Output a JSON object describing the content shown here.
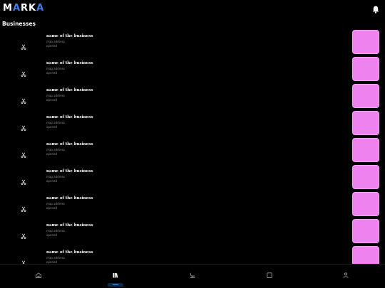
{
  "header": {
    "logo_text": "MARKA",
    "logo_accent_color": "#3f7fe6",
    "notification_icon": "bell-icon"
  },
  "section": {
    "title": "Businesses"
  },
  "businesses": [
    {
      "name": "name of the business",
      "address": "map address",
      "status": "opened",
      "category_icon": "scissors-icon",
      "thumb_color": "#ee82ee"
    },
    {
      "name": "name of the business",
      "address": "map address",
      "status": "opened",
      "category_icon": "scissors-icon",
      "thumb_color": "#ee82ee"
    },
    {
      "name": "name of the business",
      "address": "map address",
      "status": "opened",
      "category_icon": "scissors-icon",
      "thumb_color": "#ee82ee"
    },
    {
      "name": "name of the business",
      "address": "map address",
      "status": "opened",
      "category_icon": "scissors-icon",
      "thumb_color": "#ee82ee"
    },
    {
      "name": "name of the business",
      "address": "map address",
      "status": "opened",
      "category_icon": "scissors-icon",
      "thumb_color": "#ee82ee"
    },
    {
      "name": "name of the business",
      "address": "map address",
      "status": "opened",
      "category_icon": "scissors-icon",
      "thumb_color": "#ee82ee"
    },
    {
      "name": "name of the business",
      "address": "map address",
      "status": "opened",
      "category_icon": "scissors-icon",
      "thumb_color": "#ee82ee"
    },
    {
      "name": "name of the business",
      "address": "map address",
      "status": "opened",
      "category_icon": "scissors-icon",
      "thumb_color": "#ee82ee"
    },
    {
      "name": "name of the business",
      "address": "map address",
      "status": "opened",
      "category_icon": "scissors-icon",
      "thumb_color": "#ee82ee"
    }
  ],
  "bottom_nav": {
    "items": [
      {
        "icon": "home-icon",
        "active": false
      },
      {
        "icon": "library-icon",
        "active": true
      },
      {
        "icon": "salon-chair-icon",
        "active": false
      },
      {
        "icon": "calendar-icon",
        "active": false
      },
      {
        "icon": "profile-icon",
        "active": false
      }
    ],
    "active_color": "#3f9fe6"
  }
}
